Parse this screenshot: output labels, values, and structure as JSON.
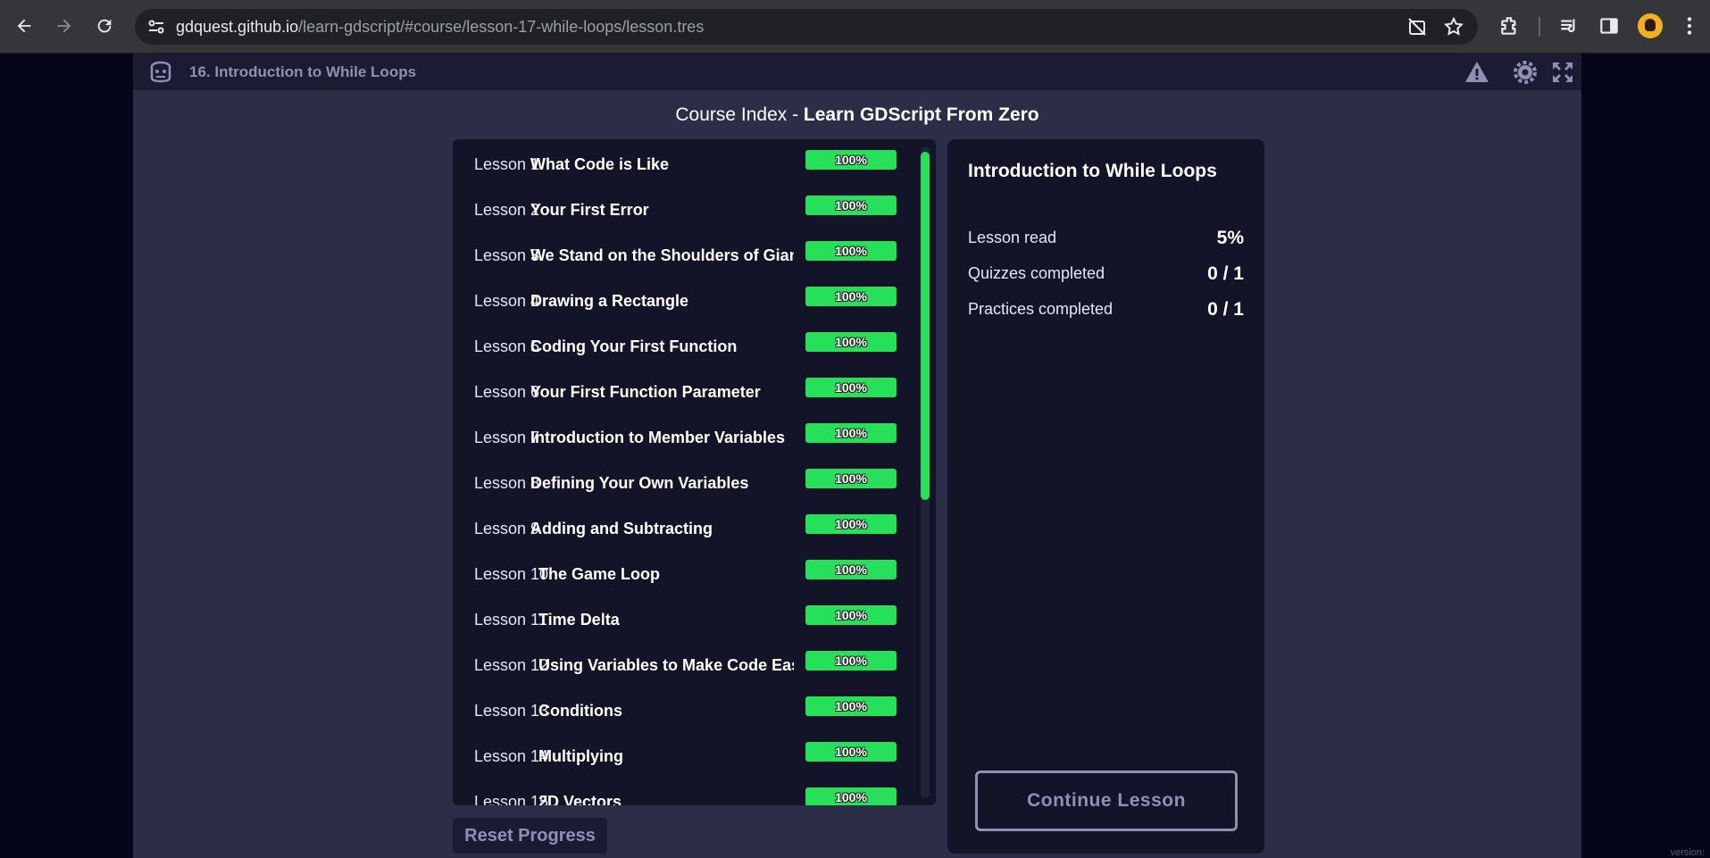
{
  "browser": {
    "url_host": "gdquest.github.io",
    "url_path": "/learn-gdscript/#course/lesson-17-while-loops/lesson.tres",
    "icons": [
      "back-icon",
      "forward-icon",
      "reload-icon",
      "site-info-icon",
      "no-camera-icon",
      "star-icon",
      "extensions-icon",
      "media-icon",
      "sidepanel-icon",
      "profile-avatar",
      "more-icon"
    ]
  },
  "topbar": {
    "title": "16. Introduction to While Loops"
  },
  "heading": {
    "prefix": "Course Index - ",
    "course": "Learn GDScript From Zero"
  },
  "lessons": [
    {
      "num": "Lesson 1",
      "name": "What Code is Like",
      "progress": "100%"
    },
    {
      "num": "Lesson 2",
      "name": "Your First Error",
      "progress": "100%"
    },
    {
      "num": "Lesson 3",
      "name": "We Stand on the Shoulders of Giants",
      "progress": "100%"
    },
    {
      "num": "Lesson 4",
      "name": "Drawing a Rectangle",
      "progress": "100%"
    },
    {
      "num": "Lesson 5",
      "name": "Coding Your First Function",
      "progress": "100%"
    },
    {
      "num": "Lesson 6",
      "name": "Your First Function Parameter",
      "progress": "100%"
    },
    {
      "num": "Lesson 7",
      "name": "Introduction to Member Variables",
      "progress": "100%"
    },
    {
      "num": "Lesson 8",
      "name": "Defining Your Own Variables",
      "progress": "100%"
    },
    {
      "num": "Lesson 9",
      "name": "Adding and Subtracting",
      "progress": "100%"
    },
    {
      "num": "Lesson 10",
      "name": "The Game Loop",
      "progress": "100%"
    },
    {
      "num": "Lesson 11",
      "name": "Time Delta",
      "progress": "100%"
    },
    {
      "num": "Lesson 12",
      "name": "Using Variables to Make Code Easier to Read",
      "progress": "100%"
    },
    {
      "num": "Lesson 13",
      "name": "Conditions",
      "progress": "100%"
    },
    {
      "num": "Lesson 14",
      "name": "Multiplying",
      "progress": "100%"
    },
    {
      "num": "Lesson 15",
      "name": "2D Vectors",
      "progress": "100%"
    }
  ],
  "reset_label": "Reset Progress",
  "detail": {
    "title": "Introduction to While Loops",
    "stats": [
      {
        "label": "Lesson read",
        "value": "5%"
      },
      {
        "label": "Quizzes completed",
        "value": "0 / 1"
      },
      {
        "label": "Practices completed",
        "value": "0 / 1"
      }
    ],
    "continue_label": "Continue Lesson"
  },
  "version_label": "version:",
  "colors": {
    "progress": "#26e05a",
    "page_bg": "#2c2d47",
    "panel_bg": "#131427",
    "muted": "#8e90b4"
  }
}
